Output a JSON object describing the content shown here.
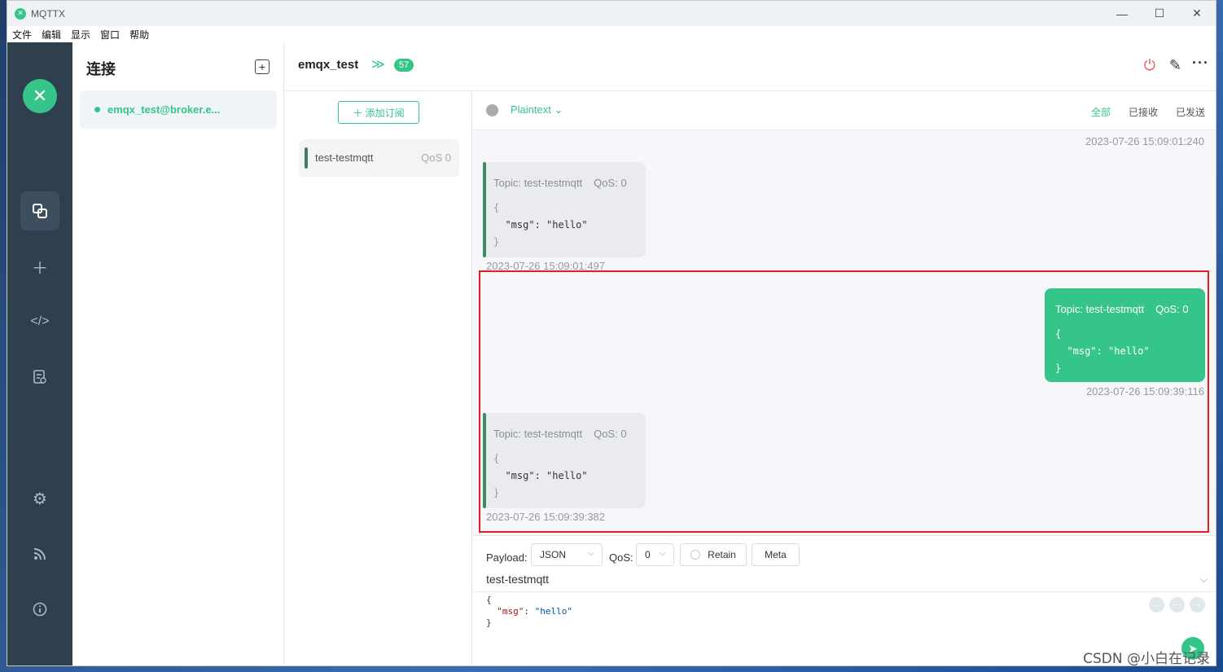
{
  "window": {
    "title": "MQTTX",
    "minimize": "—",
    "maximize": "☐",
    "close": "✕"
  },
  "menu": [
    "文件",
    "编辑",
    "显示",
    "窗口",
    "帮助"
  ],
  "sidebar": {
    "logo": "✕",
    "icons": [
      "connections-icon",
      "add-icon",
      "script-icon",
      "log-icon",
      "settings-icon",
      "rss-icon",
      "info-icon"
    ]
  },
  "connections": {
    "title": "连接",
    "add_label": "+",
    "items": [
      {
        "name": "emqx_test@broker.e...",
        "status": "connected"
      }
    ]
  },
  "topbar": {
    "name": "emqx_test",
    "chevron": "≫",
    "badge": "57"
  },
  "subscriptions": {
    "add_label": "＋  添加订阅",
    "items": [
      {
        "topic": "test-testmqtt",
        "qos": "QoS 0"
      }
    ]
  },
  "message_filter": {
    "format": "Plaintext ⌄",
    "tabs": [
      "全部",
      "已接收",
      "已发送"
    ],
    "active_tab": "全部"
  },
  "messages": [
    {
      "type": "timestamp",
      "time": "2023-07-26 15:09:01:240"
    },
    {
      "type": "received",
      "topic": "Topic: test-testmqtt",
      "qos": "QoS: 0",
      "body": [
        "{",
        "  \"msg\": \"hello\"",
        "}"
      ],
      "time": "2023-07-26 15:09:01:497"
    },
    {
      "type": "sent",
      "topic": "Topic: test-testmqtt",
      "qos": "QoS: 0",
      "body": [
        "{",
        "  \"msg\": \"hello\"",
        "}"
      ],
      "time": "2023-07-26 15:09:39:116"
    },
    {
      "type": "received",
      "topic": "Topic: test-testmqtt",
      "qos": "QoS: 0",
      "body": [
        "{",
        "  \"msg\": \"hello\"",
        "}"
      ],
      "time": "2023-07-26 15:09:39:382"
    }
  ],
  "compose": {
    "payload_label": "Payload:",
    "payload_format": "JSON",
    "qos_label": "QoS:",
    "qos_value": "0",
    "retain_label": "Retain",
    "meta_label": "Meta",
    "topic": "test-testmqtt",
    "editor": {
      "open": "{",
      "key": "\"msg\"",
      "sep": ": ",
      "value": "\"hello\"",
      "close": "}"
    }
  },
  "watermark": "CSDN @小白在记录",
  "colors": {
    "accent": "#35c48a",
    "sidebar": "#2e3f4d",
    "highlight": "#e0201b"
  }
}
